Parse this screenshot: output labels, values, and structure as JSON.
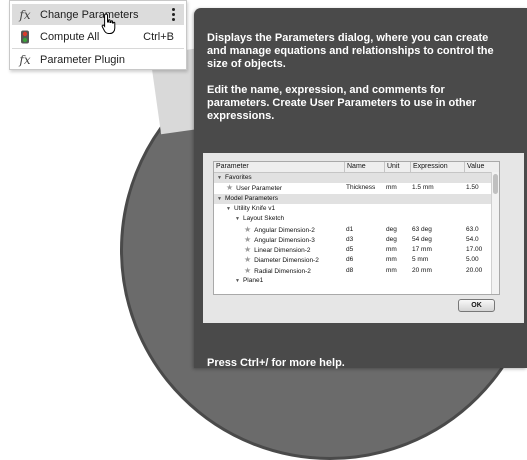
{
  "menu": {
    "items": [
      {
        "label": "Change Parameters",
        "icon": "fx-icon",
        "shortcut": ""
      },
      {
        "label": "Compute All",
        "icon": "compute-icon",
        "shortcut": "Ctrl+B"
      },
      {
        "label": "Parameter Plugin",
        "icon": "fx-plugin-icon",
        "shortcut": ""
      }
    ]
  },
  "tooltip": {
    "description": "Displays the Parameters dialog, where you can create and manage equations and relationships to control the size of objects.",
    "detail": "Edit the name, expression, and comments for parameters. Create User Parameters to use in other expressions.",
    "footer": "Press Ctrl+/ for more help."
  },
  "preview": {
    "columns": [
      "Parameter",
      "Name",
      "Unit",
      "Expression",
      "Value"
    ],
    "rows": [
      {
        "label": "Favorites",
        "indent": 0,
        "group": true,
        "name": "",
        "unit": "",
        "expr": "",
        "value": ""
      },
      {
        "label": "User Parameter",
        "indent": 1,
        "group": false,
        "name": "Thickness",
        "unit": "mm",
        "expr": "1.5 mm",
        "value": "1.50"
      },
      {
        "label": "Model Parameters",
        "indent": 0,
        "group": true,
        "name": "",
        "unit": "",
        "expr": "",
        "value": ""
      },
      {
        "label": "Utility Knife v1",
        "indent": 1,
        "group": false,
        "name": "",
        "unit": "",
        "expr": "",
        "value": ""
      },
      {
        "label": "Layout Sketch",
        "indent": 2,
        "group": false,
        "name": "",
        "unit": "",
        "expr": "",
        "value": ""
      },
      {
        "label": "Angular Dimension-2",
        "indent": 3,
        "group": false,
        "name": "d1",
        "unit": "deg",
        "expr": "63 deg",
        "value": "63.0"
      },
      {
        "label": "Angular Dimension-3",
        "indent": 3,
        "group": false,
        "name": "d3",
        "unit": "deg",
        "expr": "54 deg",
        "value": "54.0"
      },
      {
        "label": "Linear Dimension-2",
        "indent": 3,
        "group": false,
        "name": "d5",
        "unit": "mm",
        "expr": "17 mm",
        "value": "17.00"
      },
      {
        "label": "Diameter Dimension-2",
        "indent": 3,
        "group": false,
        "name": "d6",
        "unit": "mm",
        "expr": "5 mm",
        "value": "5.00"
      },
      {
        "label": "Radial Dimension-2",
        "indent": 3,
        "group": false,
        "name": "d8",
        "unit": "mm",
        "expr": "20 mm",
        "value": "20.00"
      },
      {
        "label": "Plane1",
        "indent": 2,
        "group": false,
        "name": "",
        "unit": "",
        "expr": "",
        "value": ""
      }
    ],
    "ok_label": "OK"
  },
  "colors": {
    "tooltip_bg": "#4a4a4a",
    "menu_highlight": "#dcdcdc",
    "compute_icon_red": "#d93a2b",
    "compute_icon_green": "#3aa03a"
  }
}
